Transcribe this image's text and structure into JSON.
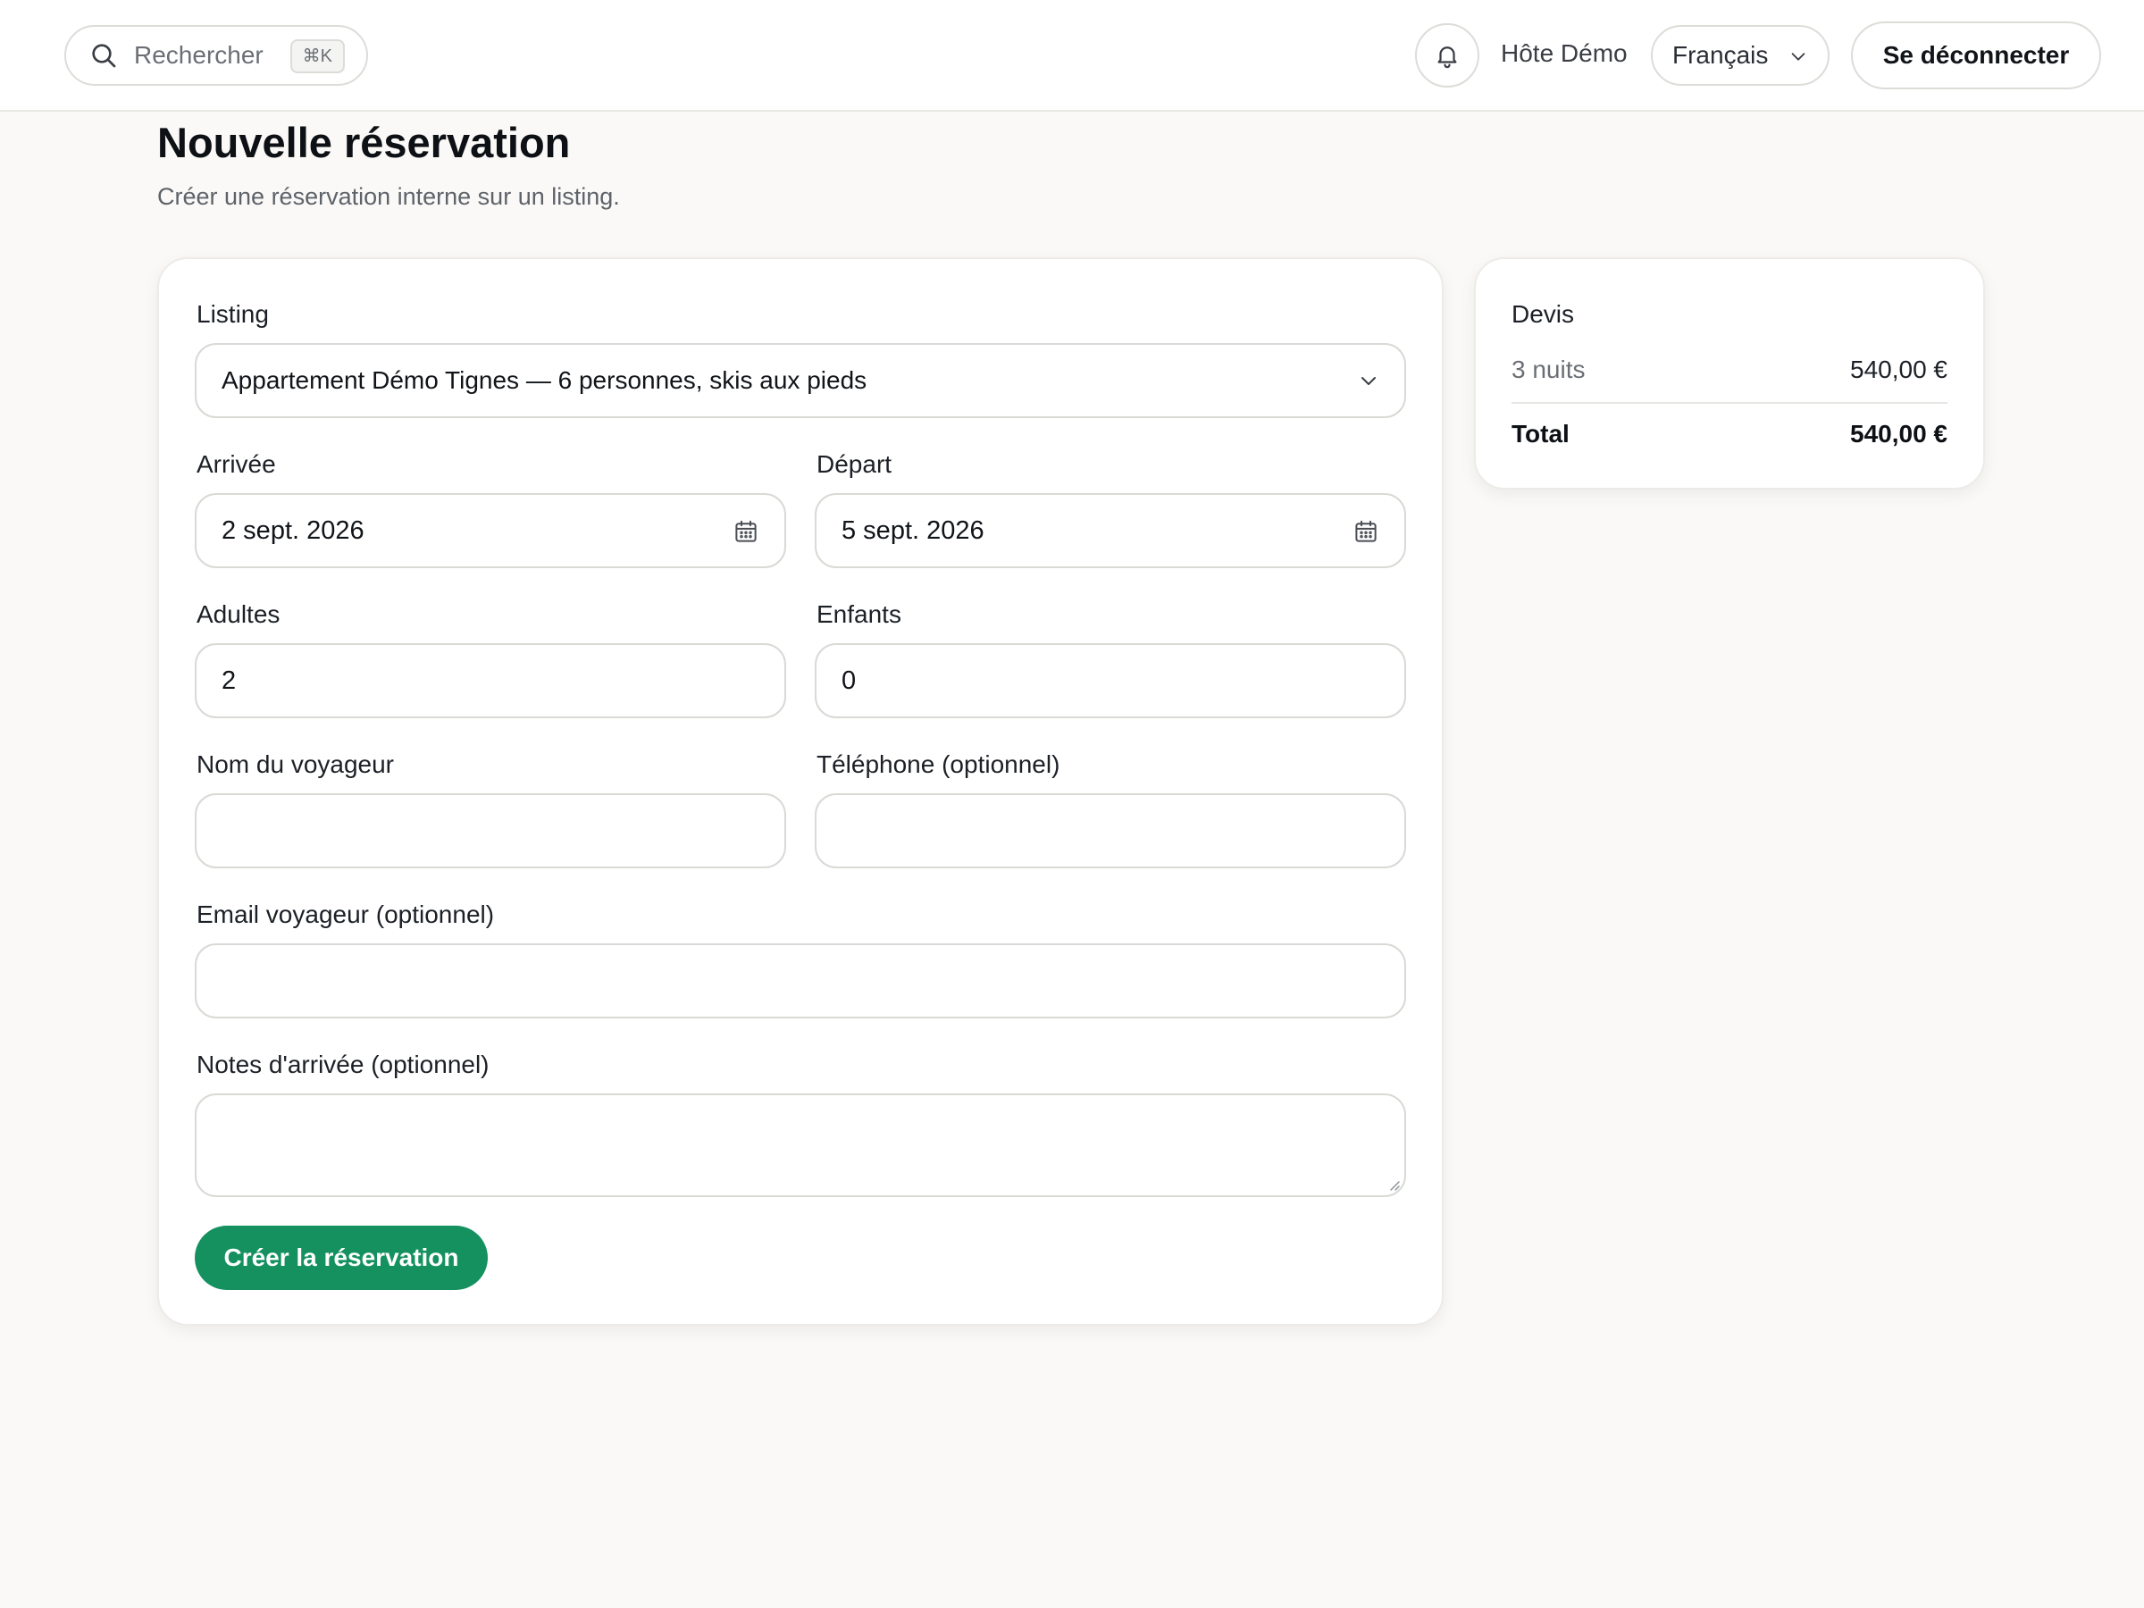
{
  "header": {
    "search": {
      "placeholder": "Rechercher",
      "shortcut": "⌘K"
    },
    "notifications_icon": "bell-icon",
    "user_name": "Hôte Démo",
    "language": {
      "selected": "Français"
    },
    "logout_label": "Se déconnecter"
  },
  "page": {
    "title": "Nouvelle réservation",
    "subtitle": "Créer une réservation interne sur un listing."
  },
  "form": {
    "listing": {
      "label": "Listing",
      "value": "Appartement Démo Tignes — 6 personnes, skis aux pieds"
    },
    "arrival": {
      "label": "Arrivée",
      "value": "2 sept. 2026"
    },
    "departure": {
      "label": "Départ",
      "value": "5 sept. 2026"
    },
    "adults": {
      "label": "Adultes",
      "value": "2"
    },
    "children": {
      "label": "Enfants",
      "value": "0"
    },
    "guest_name": {
      "label": "Nom du voyageur",
      "value": ""
    },
    "phone": {
      "label": "Téléphone (optionnel)",
      "value": ""
    },
    "email": {
      "label": "Email voyageur (optionnel)",
      "value": ""
    },
    "notes": {
      "label": "Notes d'arrivée (optionnel)",
      "value": ""
    },
    "submit_label": "Créer la réservation"
  },
  "quote": {
    "title": "Devis",
    "nights_label": "3 nuits",
    "nights_amount": "540,00 €",
    "total_label": "Total",
    "total_amount": "540,00 €"
  },
  "colors": {
    "accent": "#14915f",
    "background": "#faf9f7"
  }
}
